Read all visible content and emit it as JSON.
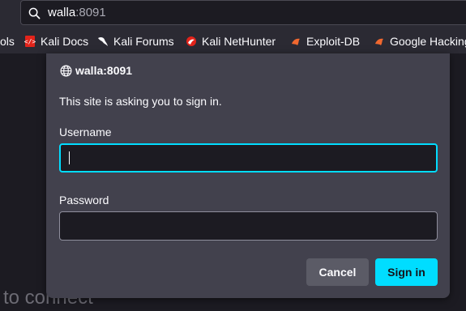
{
  "urlbar": {
    "host": "walla",
    "port": ":8091"
  },
  "bookmarks": [
    {
      "label": "ols",
      "icon": "none"
    },
    {
      "label": "Kali Docs",
      "icon": "kali-docs-icon"
    },
    {
      "label": "Kali Forums",
      "icon": "kali-dragon-icon"
    },
    {
      "label": "Kali NetHunter",
      "icon": "nethunter-icon"
    },
    {
      "label": "Exploit-DB",
      "icon": "exploitdb-icon"
    },
    {
      "label": "Google Hacking",
      "icon": "exploitdb-icon"
    }
  ],
  "page": {
    "connect_text": "to connect"
  },
  "dialog": {
    "site": "walla:8091",
    "prompt": "This site is asking you to sign in.",
    "username_label": "Username",
    "username_value": "",
    "password_label": "Password",
    "password_value": "",
    "cancel_label": "Cancel",
    "signin_label": "Sign in"
  },
  "colors": {
    "accent": "#00ddff",
    "dialog_bg": "#42414d",
    "toolbar_bg": "#2b2a33",
    "page_bg": "#1c1b22"
  }
}
